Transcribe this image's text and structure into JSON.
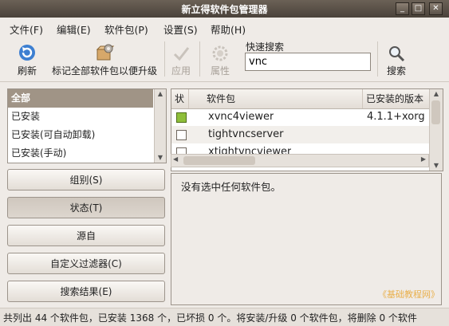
{
  "window": {
    "title": "新立得软件包管理器"
  },
  "menu": [
    "文件(F)",
    "编辑(E)",
    "软件包(P)",
    "设置(S)",
    "帮助(H)"
  ],
  "toolbar": {
    "refresh": "刷新",
    "mark_all": "标记全部软件包以便升级",
    "apply": "应用",
    "properties": "属性",
    "quick_search_label": "快速搜索",
    "quick_search_value": "vnc",
    "search": "搜索"
  },
  "filters": {
    "items": [
      "全部",
      "已安装",
      "已安装(可自动卸载)",
      "已安装(手动)"
    ],
    "selected": "全部"
  },
  "filter_buttons": [
    "组别(S)",
    "状态(T)",
    "源自",
    "自定义过滤器(C)",
    "搜索结果(E)"
  ],
  "pressed_button": "状态(T)",
  "table": {
    "headers": [
      "状",
      "软件包",
      "已安装的版本"
    ],
    "rows": [
      {
        "checked": true,
        "name": "xvnc4viewer",
        "version": "4.1.1+xorg"
      },
      {
        "checked": false,
        "name": "tightvncserver",
        "version": ""
      },
      {
        "checked": false,
        "name": "xtightvncviewer",
        "version": ""
      }
    ]
  },
  "description": {
    "text": "没有选中任何软件包。"
  },
  "watermark": "《基础教程网》",
  "statusbar": {
    "text": "共列出 44 个软件包，已安装 1368 个，已坏损 0 个。将安装/升级 0 个软件包，将删除 0 个软件"
  },
  "colors": {
    "selection": "#a09486",
    "titlebar": "#5a5148",
    "installed_check": "#8fbf3a"
  }
}
